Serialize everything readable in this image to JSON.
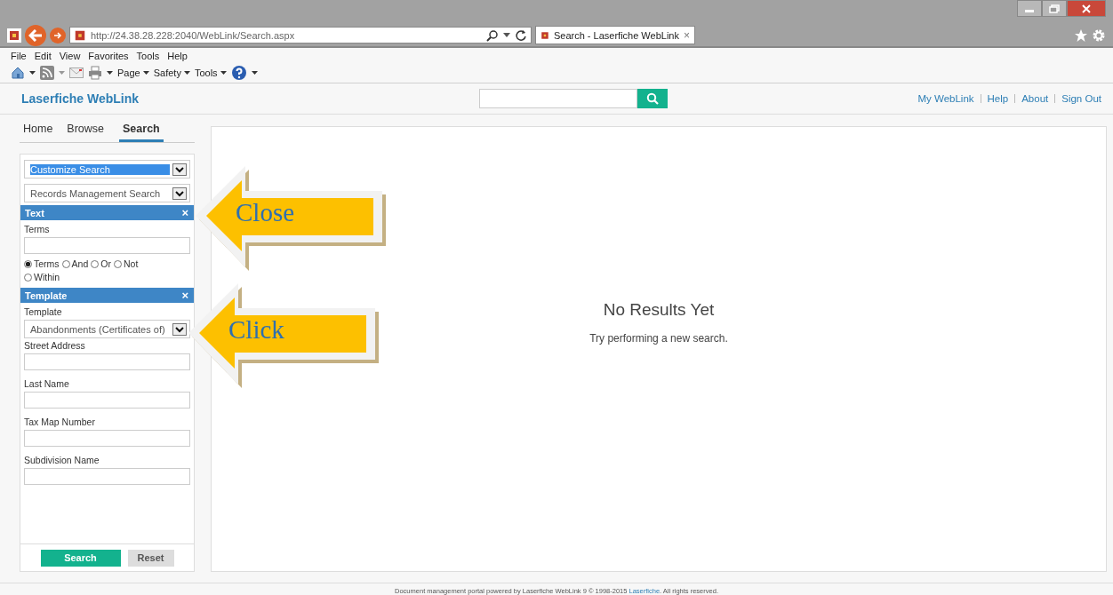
{
  "browser": {
    "address": "http://24.38.28.228:2040/WebLink/Search.aspx",
    "tab_title": "Search - Laserfiche WebLink",
    "tab_close": "×",
    "menu": [
      "File",
      "Edit",
      "View",
      "Favorites",
      "Tools",
      "Help"
    ],
    "commands": [
      "Page",
      "Safety",
      "Tools"
    ]
  },
  "header": {
    "logo": "Laserfiche WebLink",
    "links": [
      "My WebLink",
      "Help",
      "About",
      "Sign Out"
    ]
  },
  "nav_tabs": [
    {
      "label": "Home",
      "selected": false
    },
    {
      "label": "Browse",
      "selected": false
    },
    {
      "label": "Search",
      "selected": true
    }
  ],
  "sidebar": {
    "dropdowns": [
      {
        "value": "Customize Search",
        "selected": true
      },
      {
        "value": "Records Management Search",
        "selected": false
      }
    ],
    "text_section": {
      "title": "Text",
      "close": "×",
      "field_label": "Terms",
      "radios": [
        {
          "label": "Terms",
          "selected": true
        },
        {
          "label": "And",
          "selected": false
        },
        {
          "label": "Or",
          "selected": false
        },
        {
          "label": "Not",
          "selected": false
        },
        {
          "label": "Within",
          "selected": false
        }
      ]
    },
    "template_section": {
      "title": "Template",
      "close": "×",
      "template_label": "Template",
      "template_value": "Abandonments (Certificates of)",
      "fields": [
        "Street Address",
        "Last Name",
        "Tax Map Number",
        "Subdivision Name"
      ]
    },
    "buttons": [
      {
        "label": "Search",
        "kind": "primary"
      },
      {
        "label": "Reset",
        "kind": "secondary"
      }
    ]
  },
  "results": {
    "title": "No Results Yet",
    "message": "Try performing a new search."
  },
  "callouts": [
    "Close",
    "Click"
  ],
  "footer": {
    "before": "Document management portal powered by Laserfiche WebLink 9 © 1998-2015 ",
    "link": "Laserfiche",
    "after": ". All rights reserved."
  }
}
